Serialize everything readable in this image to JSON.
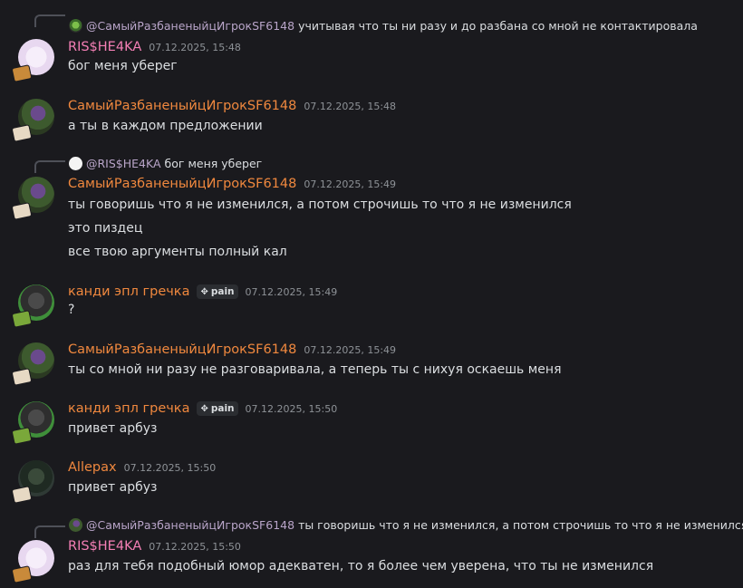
{
  "colors": {
    "background": "#1a1a1e",
    "pink_name": "#f47fb5",
    "orange_name": "#f0883e",
    "text": "#dbdee1",
    "timestamp": "#8e9297"
  },
  "messages": [
    {
      "reply": {
        "mention": "@СамыйРазбаненыйцИгрокSF6148",
        "text": "учитывая что ты ни разу и до разбана со мной не контактировала"
      },
      "author": "RIS$HE4KA",
      "timestamp": "07.12.2025, 15:48",
      "lines": [
        "бог меня уберег"
      ]
    },
    {
      "author": "СамыйРазбаненыйцИгрокSF6148",
      "timestamp": "07.12.2025, 15:48",
      "lines": [
        "а ты в каждом предложении"
      ]
    },
    {
      "reply": {
        "mention": "@RIS$HE4KA",
        "text": "бог меня уберег"
      },
      "author": "СамыйРазбаненыйцИгрокSF6148",
      "timestamp": "07.12.2025, 15:49",
      "lines": [
        "ты говоришь что я не изменился, а потом строчишь то что я не изменился",
        "это пиздец",
        "все твою аргументы полный кал"
      ]
    },
    {
      "author": "канди эпл гречка",
      "tag": "pain",
      "timestamp": "07.12.2025, 15:49",
      "lines": [
        "?"
      ]
    },
    {
      "author": "СамыйРазбаненыйцИгрокSF6148",
      "timestamp": "07.12.2025, 15:49",
      "lines": [
        "ты со мной ни разу не разговаривала, а теперь ты с нихуя оскаешь меня"
      ]
    },
    {
      "author": "канди эпл гречка",
      "tag": "pain",
      "timestamp": "07.12.2025, 15:50",
      "lines": [
        "привет арбуз"
      ]
    },
    {
      "author": "Allepax",
      "timestamp": "07.12.2025, 15:50",
      "lines": [
        "привет арбуз"
      ]
    },
    {
      "reply": {
        "mention": "@СамыйРазбаненыйцИгрокSF6148",
        "text": "ты говоришь что я не изменился, а потом строчишь то что я не изменился"
      },
      "author": "RIS$HE4KA",
      "timestamp": "07.12.2025, 15:50",
      "lines": [
        "раз для тебя подобный юмор адекватен, то я более чем уверена, что ты не изменился"
      ]
    }
  ]
}
